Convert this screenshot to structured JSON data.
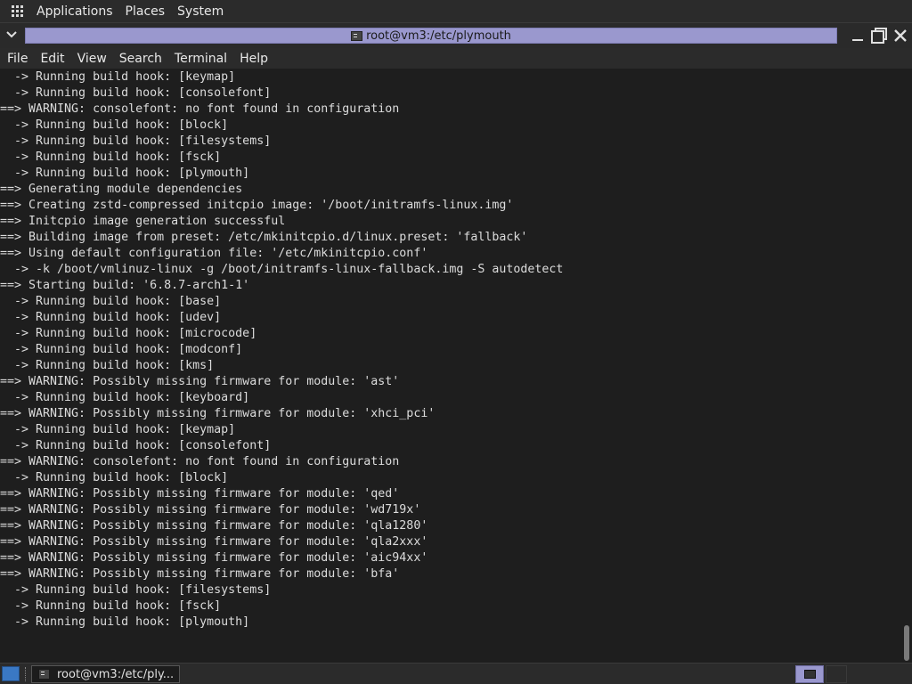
{
  "top_panel": {
    "menus": [
      "Applications",
      "Places",
      "System"
    ]
  },
  "window": {
    "title": "root@vm3:/etc/plymouth",
    "menubar": [
      "File",
      "Edit",
      "View",
      "Search",
      "Terminal",
      "Help"
    ]
  },
  "terminal": {
    "lines": [
      "  -> Running build hook: [keymap]",
      "  -> Running build hook: [consolefont]",
      "==> WARNING: consolefont: no font found in configuration",
      "  -> Running build hook: [block]",
      "  -> Running build hook: [filesystems]",
      "  -> Running build hook: [fsck]",
      "  -> Running build hook: [plymouth]",
      "==> Generating module dependencies",
      "==> Creating zstd-compressed initcpio image: '/boot/initramfs-linux.img'",
      "==> Initcpio image generation successful",
      "==> Building image from preset: /etc/mkinitcpio.d/linux.preset: 'fallback'",
      "==> Using default configuration file: '/etc/mkinitcpio.conf'",
      "  -> -k /boot/vmlinuz-linux -g /boot/initramfs-linux-fallback.img -S autodetect",
      "==> Starting build: '6.8.7-arch1-1'",
      "  -> Running build hook: [base]",
      "  -> Running build hook: [udev]",
      "  -> Running build hook: [microcode]",
      "  -> Running build hook: [modconf]",
      "  -> Running build hook: [kms]",
      "==> WARNING: Possibly missing firmware for module: 'ast'",
      "  -> Running build hook: [keyboard]",
      "==> WARNING: Possibly missing firmware for module: 'xhci_pci'",
      "  -> Running build hook: [keymap]",
      "  -> Running build hook: [consolefont]",
      "==> WARNING: consolefont: no font found in configuration",
      "  -> Running build hook: [block]",
      "==> WARNING: Possibly missing firmware for module: 'qed'",
      "==> WARNING: Possibly missing firmware for module: 'wd719x'",
      "==> WARNING: Possibly missing firmware for module: 'qla1280'",
      "==> WARNING: Possibly missing firmware for module: 'qla2xxx'",
      "==> WARNING: Possibly missing firmware for module: 'aic94xx'",
      "==> WARNING: Possibly missing firmware for module: 'bfa'",
      "  -> Running build hook: [filesystems]",
      "  -> Running build hook: [fsck]",
      "  -> Running build hook: [plymouth]"
    ]
  },
  "taskbar": {
    "task_label": "root@vm3:/etc/ply..."
  },
  "colors": {
    "title_accent": "#9a98ce",
    "terminal_bg": "#1e1e1e",
    "terminal_fg": "#dcdcdc",
    "panel_bg": "#2b2b2b"
  }
}
